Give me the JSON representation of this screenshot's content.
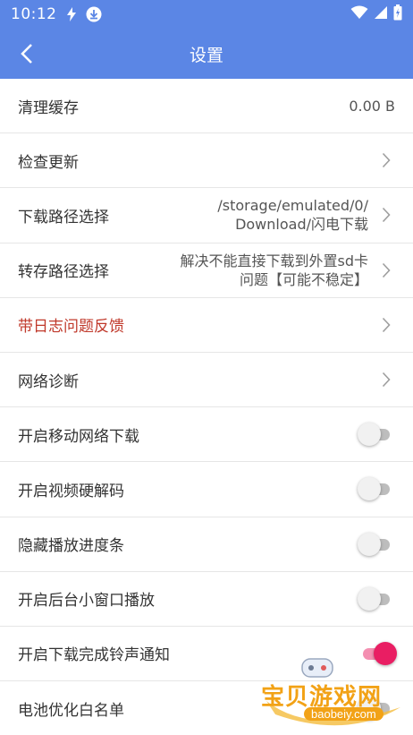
{
  "status_bar": {
    "time": "10:12",
    "icons": [
      "flash-icon",
      "download-icon",
      "wifi-icon",
      "signal-icon",
      "battery-icon"
    ]
  },
  "app_bar": {
    "title": "设置"
  },
  "settings": [
    {
      "label": "清理缓存",
      "value": "0.00 B",
      "type": "value"
    },
    {
      "label": "检查更新",
      "type": "chevron"
    },
    {
      "label": "下载路径选择",
      "value_line1": "/storage/emulated/0/",
      "value_line2": "Download/闪电下载",
      "type": "path"
    },
    {
      "label": "转存路径选择",
      "value_line1": "解决不能直接下载到外置sd卡",
      "value_line2": "问题【可能不稳定】",
      "type": "path"
    },
    {
      "label": "带日志问题反馈",
      "type": "chevron",
      "color": "#c0392b"
    },
    {
      "label": "网络诊断",
      "type": "chevron"
    },
    {
      "label": "开启移动网络下载",
      "type": "toggle",
      "on": false
    },
    {
      "label": "开启视频硬解码",
      "type": "toggle",
      "on": false
    },
    {
      "label": "隐藏播放进度条",
      "type": "toggle",
      "on": false
    },
    {
      "label": "开启后台小窗口播放",
      "type": "toggle",
      "on": false
    },
    {
      "label": "开启下载完成铃声通知",
      "type": "toggle",
      "on": true
    },
    {
      "label": "电池优化白名单",
      "type": "toggle",
      "on": false
    }
  ],
  "watermark": {
    "text": "宝贝游戏网",
    "url": "baobeiy.com"
  },
  "colors": {
    "primary": "#5b86e5",
    "accent": "#e91e63",
    "feedback_red": "#c0392b"
  }
}
